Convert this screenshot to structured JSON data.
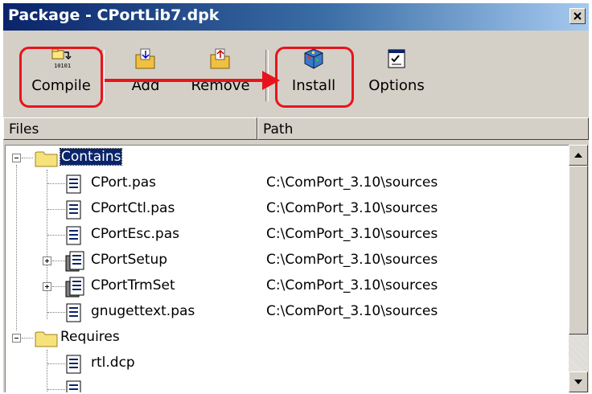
{
  "window": {
    "title": "Package - CPortLib7.dpk"
  },
  "toolbar": {
    "buttons": [
      {
        "label": "Compile",
        "icon": "compile-icon"
      },
      {
        "label": "Add",
        "icon": "add-icon"
      },
      {
        "label": "Remove",
        "icon": "remove-icon"
      },
      {
        "label": "Install",
        "icon": "install-icon"
      },
      {
        "label": "Options",
        "icon": "options-icon"
      }
    ],
    "annotation_color": "#e8141c"
  },
  "columns": {
    "files": "Files",
    "path": "Path"
  },
  "tree": {
    "contains": {
      "label": "Contains",
      "items": [
        {
          "name": "CPort.pas",
          "path": "C:\\ComPort_3.10\\sources",
          "expandable": false
        },
        {
          "name": "CPortCtl.pas",
          "path": "C:\\ComPort_3.10\\sources",
          "expandable": false
        },
        {
          "name": "CPortEsc.pas",
          "path": "C:\\ComPort_3.10\\sources",
          "expandable": false
        },
        {
          "name": "CPortSetup",
          "path": "C:\\ComPort_3.10\\sources",
          "expandable": true
        },
        {
          "name": "CPortTrmSet",
          "path": "C:\\ComPort_3.10\\sources",
          "expandable": true
        },
        {
          "name": "gnugettext.pas",
          "path": "C:\\ComPort_3.10\\sources",
          "expandable": false
        }
      ]
    },
    "requires": {
      "label": "Requires",
      "items": [
        {
          "name": "rtl.dcp",
          "path": ""
        }
      ]
    }
  },
  "colors": {
    "selection": "#0a246a",
    "face": "#d4d0c8"
  }
}
